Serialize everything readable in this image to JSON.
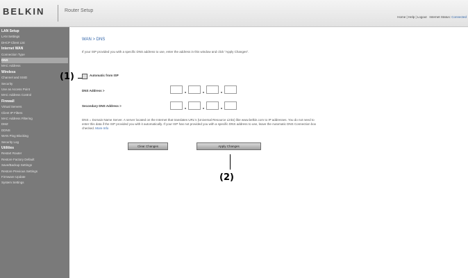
{
  "header": {
    "logo": "BELKIN",
    "title": "Router Setup",
    "links": [
      "Home",
      "Help",
      "Logout",
      "Internet Status:"
    ],
    "connection_status": "Connected"
  },
  "sidebar": {
    "items": [
      {
        "label": "LAN Setup",
        "type": "section"
      },
      {
        "label": "LAN Settings",
        "type": "item"
      },
      {
        "label": "DHCP Client List",
        "type": "item"
      },
      {
        "label": "Internet WAN",
        "type": "section"
      },
      {
        "label": "Connection Type",
        "type": "item"
      },
      {
        "label": "DNS",
        "type": "active"
      },
      {
        "label": "MAC Address",
        "type": "item"
      },
      {
        "label": "Wireless",
        "type": "section"
      },
      {
        "label": "Channel and SSID",
        "type": "item"
      },
      {
        "label": "Security",
        "type": "item"
      },
      {
        "label": "Use as Access Point",
        "type": "item"
      },
      {
        "label": "MAC Address Control",
        "type": "item"
      },
      {
        "label": "Firewall",
        "type": "section"
      },
      {
        "label": "Virtual Servers",
        "type": "item"
      },
      {
        "label": "Client IP Filters",
        "type": "item"
      },
      {
        "label": "MAC Address Filtering",
        "type": "item"
      },
      {
        "label": "DMZ",
        "type": "item"
      },
      {
        "label": "DDNS",
        "type": "item"
      },
      {
        "label": "WAN Ping Blocking",
        "type": "item"
      },
      {
        "label": "Security Log",
        "type": "item"
      },
      {
        "label": "Utilities",
        "type": "section"
      },
      {
        "label": "Restart Router",
        "type": "item"
      },
      {
        "label": "Restore Factory Default",
        "type": "item"
      },
      {
        "label": "Save/Backup Settings",
        "type": "item"
      },
      {
        "label": "Restore Previous Settings",
        "type": "item"
      },
      {
        "label": "Firmware Update",
        "type": "item"
      },
      {
        "label": "System Settings",
        "type": "item"
      }
    ]
  },
  "main": {
    "page_title": "WAN > DNS",
    "intro": "If your ISP provided you with a specific DNS address to use, enter the address in this window and click \"Apply Changes\".",
    "auto_label": "Automatic from ISP",
    "dns_label": "DNS Address >",
    "secondary_label": "Secondary DNS Address >",
    "note": "DNS = Domain Name Server. A server located on the Internet that translates URL's (Universal Resource Links) like www.belkin.com to IP addresses. You do not need to enter this data if the ISP provided you with it automatically. If your ISP has not provided you with a specific DNS address to use, leave the Automatic DNS Connection box checked.",
    "note_link": "More Info",
    "clear_button": "Clear Changes",
    "apply_button": "Apply Changes"
  },
  "callouts": {
    "one": "(1)",
    "two": "(2)"
  },
  "colors": {
    "sidebar_bg": "#7a7a7a",
    "link": "#3366aa",
    "header_bg": "#e8e8e8"
  }
}
